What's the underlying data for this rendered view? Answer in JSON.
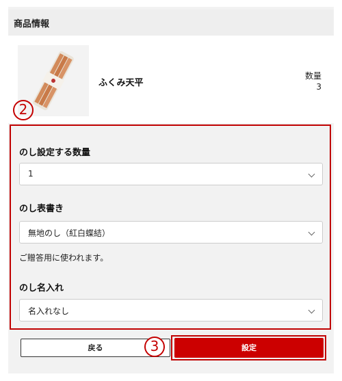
{
  "header": {
    "title": "商品情報"
  },
  "product": {
    "name": "ふくみ天平",
    "quantity_label": "数量",
    "quantity_value": "3"
  },
  "annotations": {
    "marker_2": "2",
    "marker_3": "3"
  },
  "noshi": {
    "quantity": {
      "label": "のし設定する数量",
      "value": "1"
    },
    "omote": {
      "label": "のし表書き",
      "value": "無地のし（紅白蝶結）",
      "note": "ご贈答用に使われます。"
    },
    "name": {
      "label": "のし名入れ",
      "value": "名入れなし"
    }
  },
  "buttons": {
    "back": "戻る",
    "set": "設定"
  },
  "colors": {
    "accent": "#cc0000",
    "annotation": "#c40000",
    "panel": "#f2f2f2"
  }
}
